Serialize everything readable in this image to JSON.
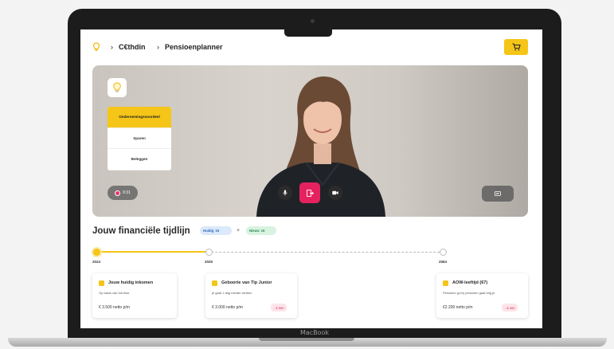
{
  "device": {
    "label": "MacBook"
  },
  "header": {
    "breadcrumb": [
      "C€thdin",
      "Pensioenplanner"
    ]
  },
  "video": {
    "menu_items": [
      "Ondernemingsvoordeel",
      "Sparen",
      "Beleggen"
    ],
    "active_menu_index": 0,
    "recording_time": "0:31"
  },
  "timeline": {
    "title": "Jouw financiële tijdlijn",
    "filters": [
      {
        "label": "Huidig",
        "count": "15"
      },
      {
        "label": "Nieuw",
        "count": "15"
      }
    ],
    "add_label": "+",
    "progress_fraction": 0.32,
    "nodes": [
      {
        "year": "2024",
        "active": true
      },
      {
        "year": "2025",
        "active": false
      },
      {
        "year": "2064",
        "active": false
      }
    ],
    "cards": [
      {
        "title": "Jouw huidig inkomen",
        "subtitle": "Op basis van full time.",
        "amount": "€ 3.500 netto p/m",
        "badge": ""
      },
      {
        "title": "Geboorte van Tip Junior",
        "subtitle": "je gaat 1 dag minder werken",
        "amount": "€ 3.000 netto p/m",
        "badge": "- € 500"
      },
      {
        "title": "AOW-leeftijd (67)",
        "subtitle": "Pensioen (p/m) pensioen gaat trilg je.",
        "amount": "€2.200 netto p/m",
        "badge": "- € 400"
      }
    ]
  },
  "colors": {
    "accent": "#f5c518",
    "leave": "#e5225f",
    "badge_text": "#d21f4d"
  }
}
